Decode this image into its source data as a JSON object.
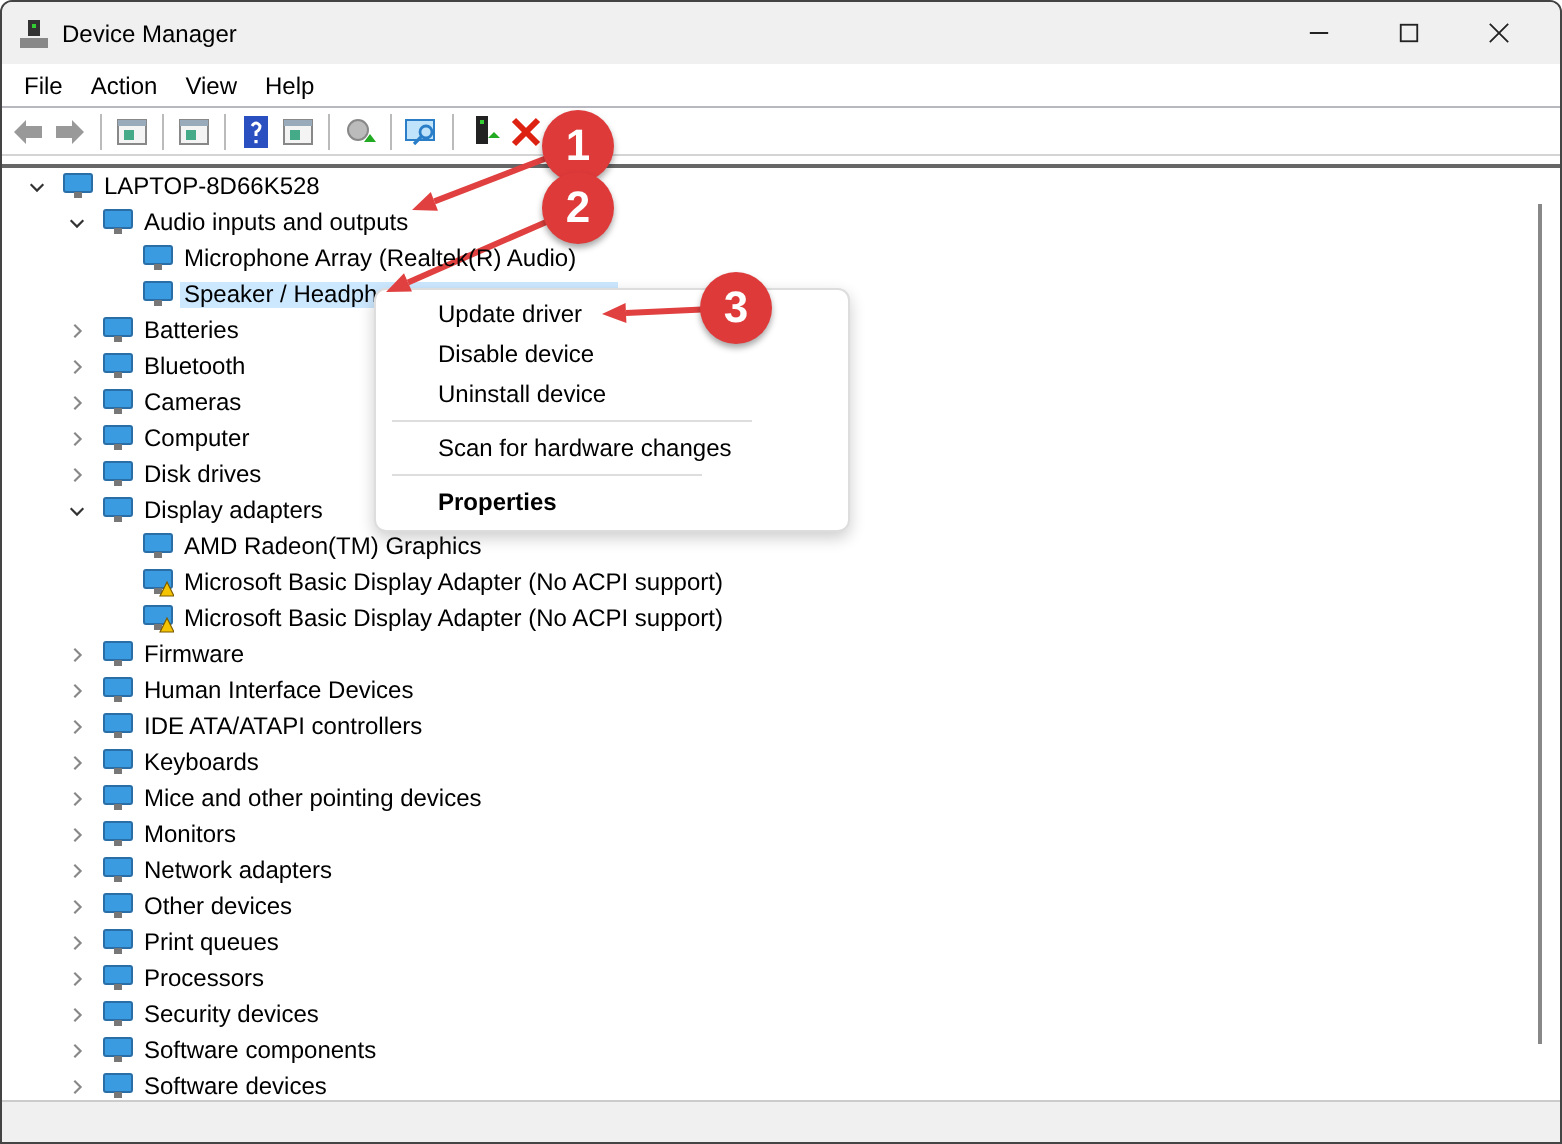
{
  "window": {
    "title": "Device Manager"
  },
  "menu": [
    "File",
    "Action",
    "View",
    "Help"
  ],
  "tree": [
    {
      "label": "LAPTOP-8D66K528",
      "expanded": true,
      "selected": false,
      "children": [
        {
          "label": "Audio inputs and outputs",
          "expanded": true,
          "selected": false,
          "children": [
            {
              "label": "Microphone Array (Realtek(R) Audio)",
              "selected": false,
              "warning": false
            },
            {
              "label": "Speaker / Headph",
              "selected": true,
              "warning": false
            }
          ]
        },
        {
          "label": "Batteries",
          "expanded": false,
          "selected": false
        },
        {
          "label": "Bluetooth",
          "expanded": false,
          "selected": false
        },
        {
          "label": "Cameras",
          "expanded": false,
          "selected": false
        },
        {
          "label": "Computer",
          "expanded": false,
          "selected": false
        },
        {
          "label": "Disk drives",
          "expanded": false,
          "selected": false
        },
        {
          "label": "Display adapters",
          "expanded": true,
          "selected": false,
          "children": [
            {
              "label": "AMD Radeon(TM) Graphics",
              "selected": false,
              "warning": false
            },
            {
              "label": "Microsoft Basic Display Adapter (No ACPI support)",
              "selected": false,
              "warning": true
            },
            {
              "label": "Microsoft Basic Display Adapter (No ACPI support)",
              "selected": false,
              "warning": true
            }
          ]
        },
        {
          "label": "Firmware",
          "expanded": false,
          "selected": false
        },
        {
          "label": "Human Interface Devices",
          "expanded": false,
          "selected": false
        },
        {
          "label": "IDE ATA/ATAPI controllers",
          "expanded": false,
          "selected": false
        },
        {
          "label": "Keyboards",
          "expanded": false,
          "selected": false
        },
        {
          "label": "Mice and other pointing devices",
          "expanded": false,
          "selected": false
        },
        {
          "label": "Monitors",
          "expanded": false,
          "selected": false
        },
        {
          "label": "Network adapters",
          "expanded": false,
          "selected": false
        },
        {
          "label": "Other devices",
          "expanded": false,
          "selected": false
        },
        {
          "label": "Print queues",
          "expanded": false,
          "selected": false
        },
        {
          "label": "Processors",
          "expanded": false,
          "selected": false
        },
        {
          "label": "Security devices",
          "expanded": false,
          "selected": false
        },
        {
          "label": "Software components",
          "expanded": false,
          "selected": false
        },
        {
          "label": "Software devices",
          "expanded": false,
          "selected": false
        }
      ]
    }
  ],
  "context_menu": [
    {
      "label": "Update driver",
      "default": false,
      "separator_before": false
    },
    {
      "label": "Disable device",
      "default": false,
      "separator_before": false
    },
    {
      "label": "Uninstall device",
      "default": false,
      "separator_before": false
    },
    {
      "label": "Scan for hardware changes",
      "default": false,
      "separator_before": true
    },
    {
      "label": "Properties",
      "default": true,
      "separator_before": true
    }
  ],
  "callouts": [
    "1",
    "2",
    "3"
  ]
}
